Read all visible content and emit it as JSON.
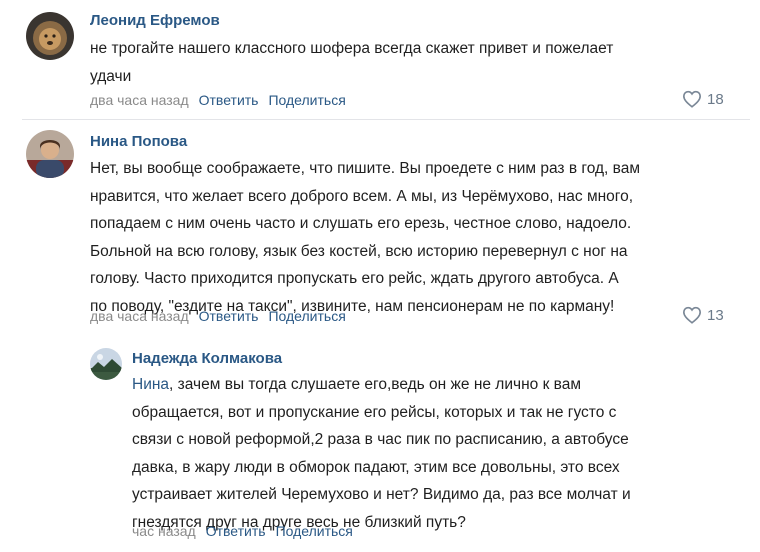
{
  "comments": [
    {
      "author": "Леонид Ефремов",
      "lines": [
        "не трогайте нашего классного шофера всегда скажет привет и пожелает",
        "удачи"
      ],
      "time": "два часа назад",
      "reply": "Ответить",
      "share": "Поделиться",
      "likes": "18",
      "avatar_icon": "lion-photo-avatar"
    },
    {
      "author": "Нина Попова",
      "lines": [
        "Нет, вы вообще соображаете, что пишите. Вы проедете с ним раз в год, вам",
        "нравится, что желает всего доброго всем. А мы, из Черёмухово, нас много,",
        "попадаем с ним очень часто и слушать его ерезь, честное слово, надоело.",
        "Больной на всю голову, язык без костей, всю историю перевернул с ног на",
        "голову. Часто приходится пропускать его рейс, ждать другого автобуса. А",
        "по поводу, \"ездите на такси\", извините, нам пенсионерам не по карману!"
      ],
      "time": "два часа назад",
      "reply": "Ответить",
      "share": "Поделиться",
      "likes": "13",
      "avatar_icon": "woman-photo-avatar"
    },
    {
      "author": "Надежда Колмакова",
      "mention": "Нина",
      "first_line_rest": ", зачем вы тогда слушаете его,ведь он же не лично к вам",
      "lines": [
        "обращается, вот и пропускание его рейсы, которых и так не густо с",
        "связи с новой реформой,2 раза в час пик по расписанию, а автобусе",
        "давка, в жару люди в обморок падают, этим все довольны, это всех",
        "устраивает жителей Черемухово и нет? Видимо да, раз все молчат и",
        "гнездятся друг на друге весь не близкий путь?"
      ],
      "time": "час назад",
      "reply": "Ответить",
      "share": "Поделиться",
      "avatar_icon": "landscape-photo-avatar"
    }
  ],
  "colors": {
    "link": "#2a5885",
    "meta": "#8a8a8a",
    "text": "#1f1f1f",
    "likes": "#6b7a8a"
  }
}
